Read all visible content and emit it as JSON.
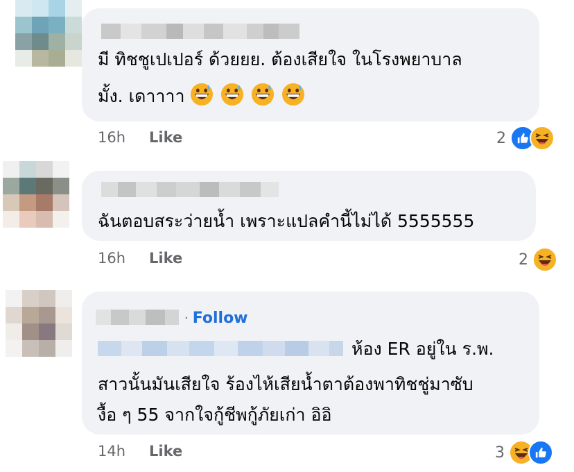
{
  "comments": [
    {
      "text_line1": "มี ทิชชูเปเปอร์  ด้วยยย. ต้องเสียใจ ในโรงพยาบาล",
      "text_line2": "มั้ง. เดาาาา",
      "emoji_count": 4,
      "time": "16h",
      "like_label": "Like",
      "reaction_count": "2",
      "reactions": [
        "like-icon",
        "haha-icon"
      ]
    },
    {
      "text_line1": "ฉันตอบสระว่ายน้ำ เพราะแปลคำนี้ไม่ได้ 5555555",
      "time": "16h",
      "like_label": "Like",
      "reaction_count": "2",
      "reactions": [
        "haha-icon"
      ]
    },
    {
      "follow_sep": "·",
      "follow_label": "Follow",
      "text_line1": "ห้อง ER อยู่ใน ร.พ.",
      "text_line2": "สาวนั้นมันเสียใจ ร้องไห้เสียน้ำตาต้องพาทิชชู่มาซับ",
      "text_line3": "งื้อ ๆ 55 จากใจกู้ชีพกู้ภัยเก่า อิอิ",
      "time": "14h",
      "like_label": "Like",
      "reaction_count": "3",
      "reactions": [
        "haha-icon",
        "like-icon"
      ]
    }
  ],
  "colors": {
    "bubble": "#f0f2f5",
    "meta_text": "#65676b",
    "follow": "#216fdb",
    "like_reaction": "#1877f2",
    "haha_reaction": "#f7b125"
  }
}
